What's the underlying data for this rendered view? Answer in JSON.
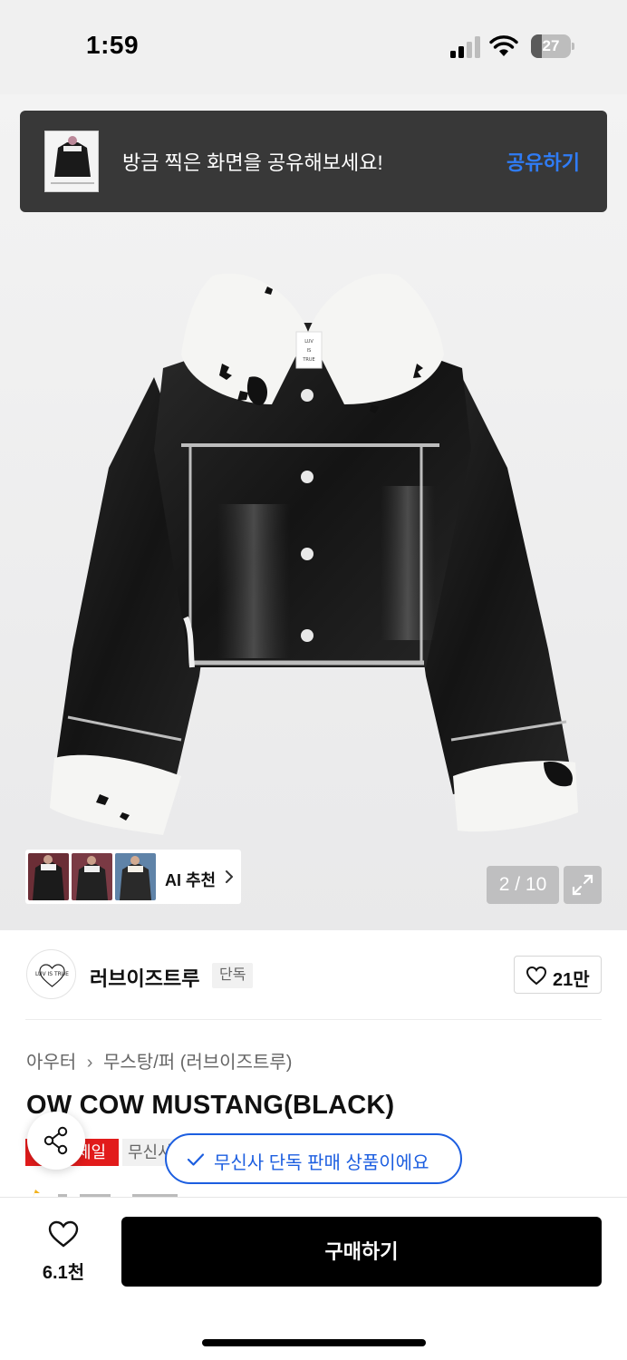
{
  "status_bar": {
    "time": "1:59",
    "battery_level": "27"
  },
  "share_banner": {
    "message": "방금 찍은 화면을 공유해보세요!",
    "action_label": "공유하기"
  },
  "gallery": {
    "ai_recommend_label": "AI 추천",
    "page_counter": "2 / 10"
  },
  "brand": {
    "name": "러브이즈트루",
    "badge": "단독",
    "logo_text": "LUV IS TRUE",
    "like_count": "21만"
  },
  "product": {
    "category_primary": "아우터",
    "category_secondary": "무스탕/퍼 (러브이즈트루)",
    "title": "OW COW MUSTANG(BLACK)",
    "sale_badge": "세일",
    "musinsa_badge": "무신사",
    "exclusive_toast": "무신사 단독 판매 상품이에요",
    "collar_label": "LUV IS TRUE"
  },
  "bottom_bar": {
    "wish_count": "6.1천",
    "buy_label": "구매하기"
  },
  "colors": {
    "accent_blue": "#2f7cf6",
    "toast_blue": "#1c5ee0",
    "sale_red": "#e21b1b",
    "banner_bg": "#383838",
    "buy_button": "#000000"
  },
  "icons": {
    "signal": "cellular-signal-icon",
    "wifi": "wifi-icon",
    "battery": "battery-icon",
    "expand": "expand-icon",
    "chevron": "chevron-right-icon",
    "heart": "heart-icon",
    "share": "share-icon",
    "check": "check-icon"
  }
}
